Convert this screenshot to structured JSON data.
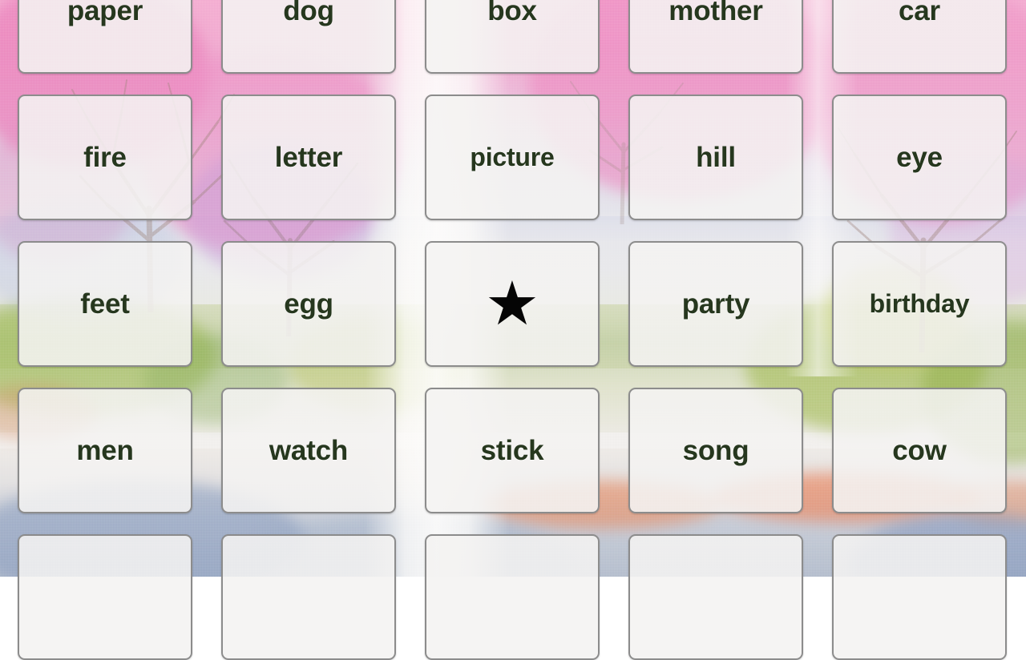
{
  "card": {
    "type": "bingo-word-grid",
    "columns": 5,
    "free_space_symbol": "★",
    "text_color": "#26371e",
    "card_background": "#f4f3f1",
    "card_border_color": "#8c8c8c",
    "background_theme": "watercolor-landscape-pink-blossom",
    "rows": [
      [
        {
          "label": "paper",
          "free": false
        },
        {
          "label": "dog",
          "free": false
        },
        {
          "label": "box",
          "free": false
        },
        {
          "label": "mother",
          "free": false
        },
        {
          "label": "car",
          "free": false
        }
      ],
      [
        {
          "label": "fire",
          "free": false
        },
        {
          "label": "letter",
          "free": false
        },
        {
          "label": "picture",
          "free": false
        },
        {
          "label": "hill",
          "free": false
        },
        {
          "label": "eye",
          "free": false
        }
      ],
      [
        {
          "label": "feet",
          "free": false
        },
        {
          "label": "egg",
          "free": false
        },
        {
          "label": "★",
          "free": true
        },
        {
          "label": "party",
          "free": false
        },
        {
          "label": "birthday",
          "free": false
        }
      ],
      [
        {
          "label": "men",
          "free": false
        },
        {
          "label": "watch",
          "free": false
        },
        {
          "label": "stick",
          "free": false
        },
        {
          "label": "song",
          "free": false
        },
        {
          "label": "cow",
          "free": false
        }
      ],
      [
        {
          "label": "",
          "free": false
        },
        {
          "label": "",
          "free": false
        },
        {
          "label": "",
          "free": false
        },
        {
          "label": "",
          "free": false
        },
        {
          "label": "",
          "free": false
        }
      ]
    ]
  }
}
